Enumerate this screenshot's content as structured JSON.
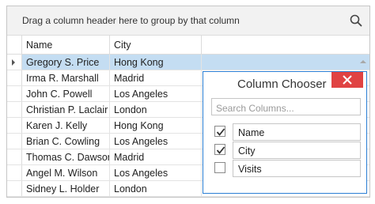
{
  "grid": {
    "group_panel_text": "Drag a column header here to group by that column",
    "columns": [
      "Name",
      "City"
    ],
    "rows": [
      {
        "name": "Gregory S. Price",
        "city": "Hong Kong",
        "selected": true
      },
      {
        "name": "Irma R. Marshall",
        "city": "Madrid"
      },
      {
        "name": "John C. Powell",
        "city": "Los Angeles"
      },
      {
        "name": "Christian P. Laclair",
        "city": "London"
      },
      {
        "name": "Karen J. Kelly",
        "city": "Hong Kong"
      },
      {
        "name": "Brian C. Cowling",
        "city": "Los Angeles"
      },
      {
        "name": "Thomas C. Dawson",
        "city": "Madrid"
      },
      {
        "name": "Angel M. Wilson",
        "city": "Los Angeles"
      },
      {
        "name": "Sidney L. Holder",
        "city": "London"
      }
    ],
    "selected_color": "#c4ddf2"
  },
  "column_chooser": {
    "title": "Column Chooser",
    "search_placeholder": "Search Columns...",
    "items": [
      {
        "label": "Name",
        "checked": true
      },
      {
        "label": "City",
        "checked": true
      },
      {
        "label": "Visits",
        "checked": false
      }
    ],
    "accent_color": "#2b7fd4",
    "close_color": "#e04343"
  },
  "icons": {
    "search": "search-icon",
    "close": "close-icon",
    "row_indicator": "row-indicator-arrow-icon",
    "checkbox": "check-icon"
  }
}
